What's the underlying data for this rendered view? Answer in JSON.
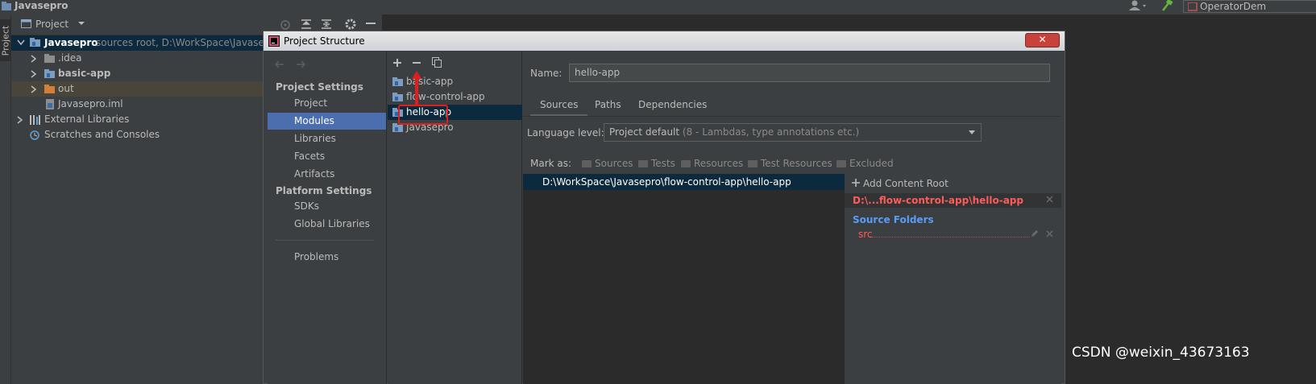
{
  "ide": {
    "project_name": "Javasepro",
    "top_right_label": "OperatorDem",
    "toolstrip_tab": "Project"
  },
  "project_panel": {
    "header_label": "Project",
    "tree": [
      {
        "name": "Javasepro",
        "suffix": "sources root,  D:\\WorkSpace\\Javasep"
      },
      {
        "name": ".idea"
      },
      {
        "name": "basic-app"
      },
      {
        "name": "out"
      },
      {
        "name": "Javasepro.iml"
      },
      {
        "name": "External Libraries"
      },
      {
        "name": "Scratches and Consoles"
      }
    ]
  },
  "dialog": {
    "title": "Project Structure",
    "close_label": "✕",
    "nav": {
      "section_project": "Project Settings",
      "project_items": [
        "Project",
        "Modules",
        "Libraries",
        "Facets",
        "Artifacts"
      ],
      "section_platform": "Platform Settings",
      "platform_items": [
        "SDKs",
        "Global Libraries"
      ],
      "problems": "Problems",
      "selected": "Modules"
    },
    "modules": [
      "basic-app",
      "flow-control-app",
      "hello-app",
      "Javasepro"
    ],
    "selected_module": "hello-app",
    "name_label": "Name:",
    "name_value": "hello-app",
    "tabs": [
      "Sources",
      "Paths",
      "Dependencies"
    ],
    "selected_tab": "Sources",
    "language_level_label": "Language level:",
    "language_level_value": "Project default",
    "language_level_hint": "(8 - Lambdas, type annotations etc.)",
    "mark_as_label": "Mark as:",
    "mark_as_options": [
      "Sources",
      "Tests",
      "Resources",
      "Test Resources",
      "Excluded"
    ],
    "content_root_path": "D:\\WorkSpace\\Javasepro\\flow-control-app\\hello-app",
    "add_content_root": "Add Content Root",
    "root_short": "D:\\...flow-control-app\\hello-app",
    "source_folders_label": "Source Folders",
    "source_folder": "src"
  },
  "watermark": "CSDN @weixin_43673163",
  "colors": {
    "selection_blue": "#4b6eaf",
    "selection_dark": "#0d293e",
    "error_red": "#ff5b5b",
    "link_blue": "#589df6",
    "annotation_red": "#e01e1e"
  }
}
